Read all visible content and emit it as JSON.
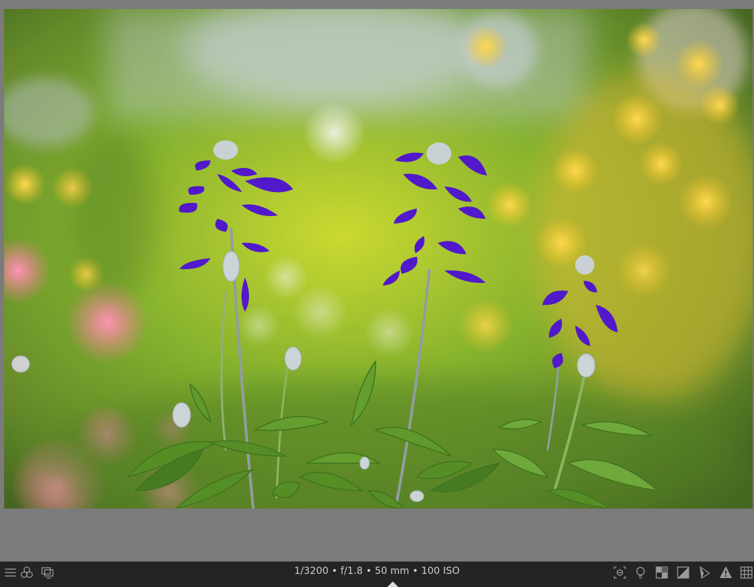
{
  "app": {
    "status_bar": {
      "exif_text": "1/3200 • f/1.8 • 50 mm • 100 ISO"
    },
    "left_tools": [
      {
        "icon": "menu-icon"
      },
      {
        "icon": "color-picker-icon"
      },
      {
        "icon": "second-window-icon"
      }
    ],
    "right_tools": [
      {
        "icon": "focus-peaking-icon"
      },
      {
        "icon": "bulb-icon"
      },
      {
        "icon": "iso-preview-icon"
      },
      {
        "icon": "softproof-icon"
      },
      {
        "icon": "gamut-check-icon"
      },
      {
        "icon": "overexposed-warning-icon"
      },
      {
        "icon": "guides-icon"
      }
    ],
    "colors": {
      "background": "#7b7b7b",
      "bar": "#242424",
      "text": "#d0d0d0",
      "flower_purple": "#4a10c8",
      "flower_yellow": "#e8b21a",
      "bokeh_pink": "#f25b8e",
      "foliage_green": "#4f8a1d"
    }
  }
}
